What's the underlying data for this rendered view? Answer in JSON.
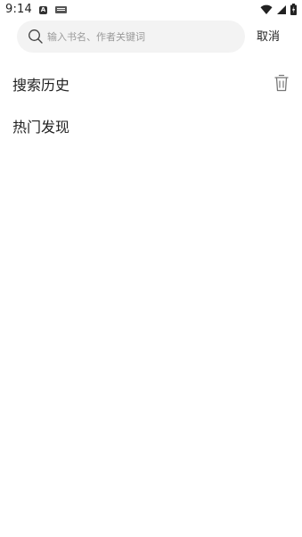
{
  "status_bar": {
    "time": "9:14",
    "app_badge": "A",
    "icons": [
      "app-a-icon",
      "keyboard-icon",
      "wifi-icon",
      "signal-icon",
      "battery-charging-icon"
    ]
  },
  "search": {
    "placeholder": "输入书名、作者关键词",
    "value": "",
    "cancel_label": "取消"
  },
  "sections": {
    "history_title": "搜索历史",
    "hot_title": "热门发现"
  },
  "colors": {
    "search_bg": "#f3f3f3",
    "placeholder": "#9a9a9a",
    "text": "#222222"
  }
}
